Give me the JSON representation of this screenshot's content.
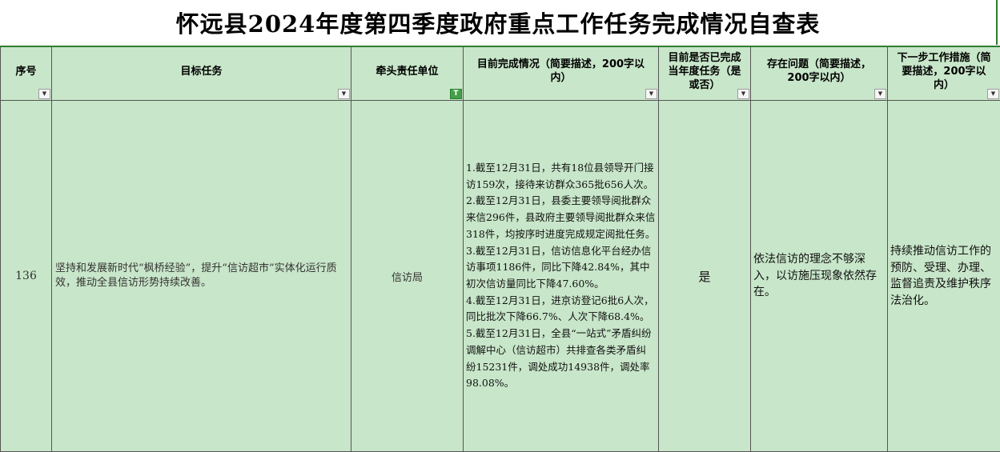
{
  "title": "怀远县2024年度第四季度政府重点工作任务完成情况自查表",
  "headers": {
    "index": "序号",
    "task": "目标任务",
    "unit": "牵头责任单位",
    "status": "目前完成情况（简要描述，200字以内）",
    "completed": "目前是否已完成当年度任务（是或否）",
    "problems": "存在问题（简要描述，200字以内）",
    "next_steps": "下一步工作措施（简要描述，200字以内）"
  },
  "filter_icons": {
    "dropdown": "▼",
    "active_filter": "T"
  },
  "row": {
    "index": "136",
    "task": "坚持和发展新时代“枫桥经验”，提升“信访超市”实体化运行质效，推动全县信访形势持续改善。",
    "unit": "信访局",
    "status_lines": [
      "1.截至12月31日，共有18位县领导开门接访159次，接待来访群众365批656人次。",
      "2.截至12月31日，县委主要领导阅批群众来信296件，县政府主要领导阅批群众来信318件，均按序时进度完成规定阅批任务。",
      "3.截至12月31日，信访信息化平台经办信访事项1186件，同比下降42.84%，其中初次信访量同比下降47.60%。",
      "4.截至12月31日，进京访登记6批6人次，同比批次下降66.7%、人次下降68.4%。",
      "5.截至12月31日，全县“一站式”矛盾纠纷调解中心（信访超市）共排查各类矛盾纠纷15231件，调处成功14938件，调处率98.08%。"
    ],
    "completed": "是",
    "problems": "依法信访的理念不够深入，以访施压现象依然存在。",
    "next_steps": "持续推动信访工作的预防、受理、办理、监督追责及维护秩序法治化。"
  }
}
